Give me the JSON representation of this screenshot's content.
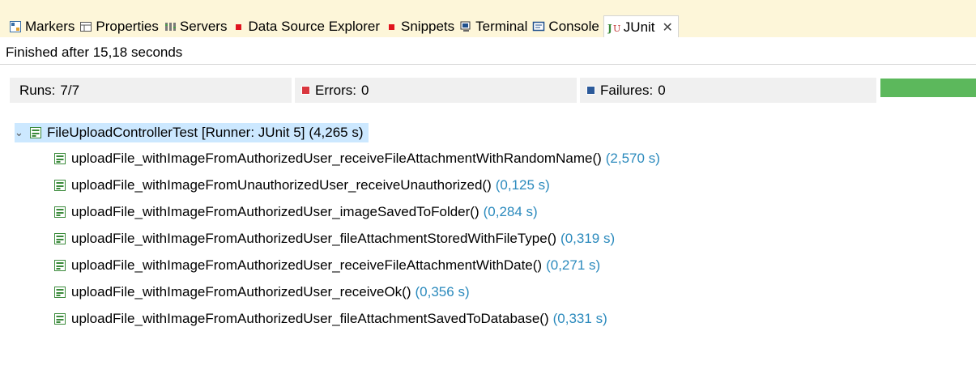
{
  "tabs": [
    {
      "label": "Markers",
      "icon": "markers-icon"
    },
    {
      "label": "Properties",
      "icon": "properties-icon"
    },
    {
      "label": "Servers",
      "icon": "servers-icon"
    },
    {
      "label": "Data Source Explorer",
      "icon": "data-source-icon"
    },
    {
      "label": "Snippets",
      "icon": "snippets-icon"
    },
    {
      "label": "Terminal",
      "icon": "terminal-icon"
    },
    {
      "label": "Console",
      "icon": "console-icon"
    },
    {
      "label": "JUnit",
      "icon": "junit-icon",
      "active": true
    }
  ],
  "status": "Finished after 15,18 seconds",
  "counters": {
    "runs_label": "Runs:",
    "runs_value": "7/7",
    "errors_label": "Errors:",
    "errors_value": "0",
    "failures_label": "Failures:",
    "failures_value": "0",
    "progress": 1.0,
    "progress_color": "#5cb85c"
  },
  "tree": {
    "root": {
      "name": "FileUploadControllerTest [Runner: JUnit 5]",
      "duration": "(4,265 s)"
    },
    "tests": [
      {
        "name": "uploadFile_withImageFromAuthorizedUser_receiveFileAttachmentWithRandomName()",
        "duration": "(2,570 s)"
      },
      {
        "name": "uploadFile_withImageFromUnauthorizedUser_receiveUnauthorized()",
        "duration": "(0,125 s)"
      },
      {
        "name": "uploadFile_withImageFromAuthorizedUser_imageSavedToFolder()",
        "duration": "(0,284 s)"
      },
      {
        "name": "uploadFile_withImageFromAuthorizedUser_fileAttachmentStoredWithFileType()",
        "duration": "(0,319 s)"
      },
      {
        "name": "uploadFile_withImageFromAuthorizedUser_receiveFileAttachmentWithDate()",
        "duration": "(0,271 s)"
      },
      {
        "name": "uploadFile_withImageFromAuthorizedUser_receiveOk()",
        "duration": "(0,356 s)"
      },
      {
        "name": "uploadFile_withImageFromAuthorizedUser_fileAttachmentSavedToDatabase()",
        "duration": "(0,331 s)"
      }
    ]
  }
}
